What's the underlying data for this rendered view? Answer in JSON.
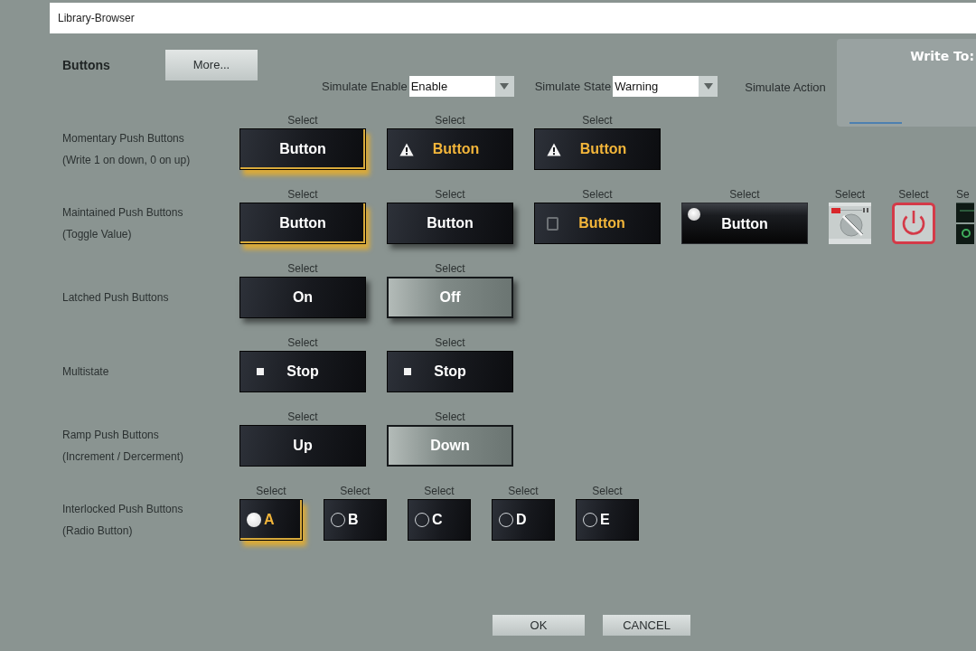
{
  "window": {
    "title": "Library-Browser"
  },
  "header": {
    "title": "Buttons",
    "more_button": "More..."
  },
  "simulate": [
    {
      "kind": "dropdown",
      "label": "Simulate Enable",
      "value": "Enable"
    },
    {
      "kind": "dropdown",
      "label": "Simulate State",
      "value": "Warning"
    },
    {
      "kind": "action",
      "label": "Simulate Action"
    }
  ],
  "write_to": {
    "title": "Write To:"
  },
  "rows": [
    {
      "label": "Momentary Push Buttons",
      "sublabel": "(Write 1 on down, 0 on up)",
      "items": [
        {
          "caption": "Select",
          "kind": "plain",
          "text": "Button",
          "dimmed": false,
          "selected": true,
          "raised": false
        },
        {
          "caption": "Select",
          "kind": "warning",
          "text": "Button",
          "dimmed": false,
          "selected": false,
          "raised": false
        },
        {
          "caption": "Select",
          "kind": "warning",
          "text": "Button",
          "dimmed": false,
          "selected": false,
          "raised": false
        }
      ]
    },
    {
      "label": "Maintained Push Buttons",
      "sublabel": "(Toggle Value)",
      "items": [
        {
          "caption": "Select",
          "kind": "plain",
          "text": "Button",
          "dimmed": false,
          "selected": true,
          "raised": false
        },
        {
          "caption": "Select",
          "kind": "plain",
          "text": "Button",
          "dimmed": false,
          "selected": false,
          "raised": true
        },
        {
          "caption": "Select",
          "kind": "checkbox",
          "text": "Button",
          "dimmed": false,
          "selected": false,
          "raised": false,
          "checked": false
        },
        {
          "caption": "Select",
          "kind": "led",
          "text": "Button",
          "selected": false,
          "raised": false
        },
        {
          "caption": "Select",
          "kind": "selector",
          "selected": false
        },
        {
          "caption": "Select",
          "kind": "power",
          "selected": false
        },
        {
          "caption": "Se",
          "kind": "switch",
          "selected": false
        }
      ]
    },
    {
      "label": "Latched Push Buttons",
      "items": [
        {
          "caption": "Select",
          "kind": "plain",
          "text": "On",
          "dimmed": false,
          "selected": false,
          "raised": true
        },
        {
          "caption": "Select",
          "kind": "plain",
          "text": "Off",
          "dimmed": true,
          "selected": false,
          "raised": true
        }
      ]
    },
    {
      "label": "Multistate",
      "items": [
        {
          "caption": "Select",
          "kind": "stop",
          "text": "Stop",
          "dimmed": false,
          "selected": false,
          "raised": false
        },
        {
          "caption": "Select",
          "kind": "stop",
          "text": "Stop",
          "dimmed": false,
          "selected": false,
          "raised": false
        }
      ]
    },
    {
      "label": "Ramp Push Buttons",
      "sublabel": "(Increment / Dercerment)",
      "items": [
        {
          "caption": "Select",
          "kind": "plain",
          "text": "Up",
          "dimmed": false,
          "selected": false,
          "raised": false
        },
        {
          "caption": "Select",
          "kind": "plain",
          "text": "Down",
          "dimmed": true,
          "selected": false,
          "raised": false
        }
      ]
    },
    {
      "label": "Interlocked Push Buttons",
      "sublabel": "(Radio Button)",
      "items": [
        {
          "caption": "Select",
          "kind": "radio",
          "text": "A",
          "dimmed": false,
          "selected": true,
          "raised": false
        },
        {
          "caption": "Select",
          "kind": "radio",
          "text": "B",
          "dimmed": false,
          "selected": false,
          "raised": false
        },
        {
          "caption": "Select",
          "kind": "radio",
          "text": "C",
          "dimmed": false,
          "selected": false,
          "raised": false
        },
        {
          "caption": "Select",
          "kind": "radio",
          "text": "D",
          "dimmed": false,
          "selected": false,
          "raised": false
        },
        {
          "caption": "Select",
          "kind": "radio",
          "text": "E",
          "dimmed": false,
          "selected": false,
          "raised": false
        }
      ]
    }
  ],
  "footer": {
    "buttons": [
      "OK",
      "CANCEL"
    ]
  }
}
